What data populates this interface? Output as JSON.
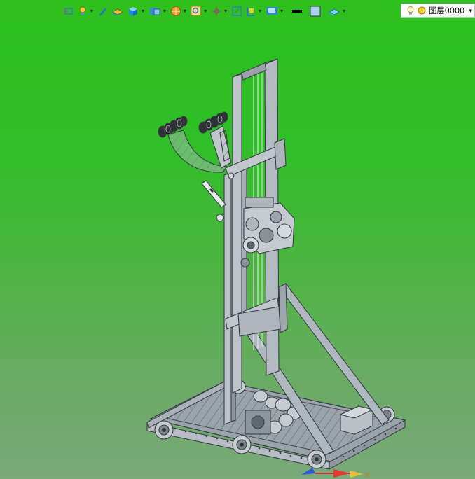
{
  "toolbar": {
    "buttons": [
      {
        "name": "snap-icon",
        "color": "#2e7dd7"
      },
      {
        "name": "lightbulb-icon",
        "color": "#f2c43a"
      },
      {
        "name": "pencil-icon",
        "color": "#2b73c9"
      },
      {
        "name": "surface-icon",
        "color": "#e9c13c"
      },
      {
        "name": "box-icon",
        "color": "#2b8fe0"
      },
      {
        "name": "3d-view-icon",
        "color": "#3a8ad8"
      },
      {
        "name": "sphere-icon",
        "color": "#f09a2a"
      },
      {
        "name": "zoom-icon",
        "color": "#e0a52a"
      },
      {
        "name": "axis-icon",
        "color": "#d24a2a"
      },
      {
        "name": "fit-view-icon",
        "color": "#3a7bd0"
      },
      {
        "name": "section-icon",
        "color": "#2e6fbf"
      },
      {
        "name": "display-mode-icon",
        "color": "#2f86d6"
      },
      {
        "name": "line-thickness-icon",
        "color": "#000000"
      },
      {
        "name": "fill-color-icon",
        "color": "#a7d3f2"
      },
      {
        "name": "material-icon",
        "color": "#3aa8c8"
      }
    ]
  },
  "layer": {
    "label": "图层0000"
  },
  "axes": {
    "x_label": "X"
  },
  "colors": {
    "background_top": "#2ec11d",
    "background_bottom": "#7aa97a",
    "model_stroke": "#3a3f45",
    "model_fill": "#a9b1ba"
  }
}
